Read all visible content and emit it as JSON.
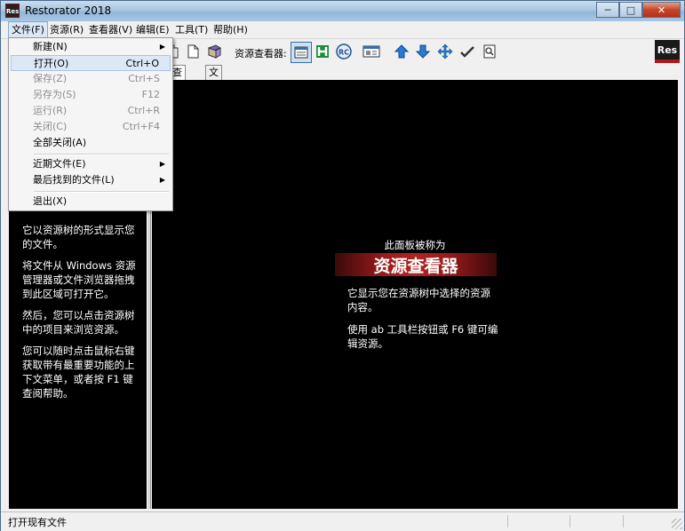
{
  "window": {
    "title": "Restorator 2018",
    "icon_text": "Res"
  },
  "caption": {
    "minimize": "─",
    "maximize": "□",
    "close": "✕"
  },
  "menubar": {
    "file": "文件(F)",
    "resources": "资源(R)",
    "viewer": "查看器(V)",
    "edit": "编辑(E)",
    "tools": "工具(T)",
    "help": "帮助(H)"
  },
  "toolbar": {
    "viewer_label": "资源查看器:",
    "icons": [
      "copy-icon",
      "page-icon",
      "book-icon",
      "viewer-grid-icon",
      "h-icon",
      "rc-icon",
      "resource-icon",
      "arrow-up-icon",
      "arrow-down-icon",
      "move-icon",
      "checkmark-icon",
      "search-page-icon"
    ],
    "logo_text": "Res"
  },
  "file_menu": {
    "items": [
      {
        "label": "新建(N)",
        "shortcut": "",
        "submenu": true,
        "enabled": true
      },
      {
        "label": "打开(O)",
        "shortcut": "Ctrl+O",
        "submenu": false,
        "enabled": true
      },
      {
        "label": "保存(Z)",
        "shortcut": "Ctrl+S",
        "submenu": false,
        "enabled": false
      },
      {
        "label": "另存为(S)",
        "shortcut": "F12",
        "submenu": false,
        "enabled": false
      },
      {
        "label": "运行(R)",
        "shortcut": "Ctrl+R",
        "submenu": false,
        "enabled": false
      },
      {
        "label": "关闭(C)",
        "shortcut": "Ctrl+F4",
        "submenu": false,
        "enabled": false
      },
      {
        "label": "全部关闭(A)",
        "shortcut": "",
        "submenu": false,
        "enabled": true
      },
      {
        "label": "近期文件(E)",
        "shortcut": "",
        "submenu": true,
        "enabled": true
      },
      {
        "label": "最后找到的文件(L)",
        "shortcut": "",
        "submenu": true,
        "enabled": true
      },
      {
        "label": "退出(X)",
        "shortcut": "",
        "submenu": false,
        "enabled": true
      }
    ],
    "submenu_arrow": "▶"
  },
  "left_panel": {
    "paragraphs": [
      "它以资源树的形式显示您的文件。",
      "将文件从 Windows 资源管理器或文件浏览器拖拽到此区域可打开它。",
      "然后，您可以点击资源树中的项目来浏览资源。",
      "您可以随时点击鼠标右键获取带有最重要功能的上下文菜单，或者按 F1 键查阅帮助。"
    ]
  },
  "tabs": {
    "viewer": "查看器",
    "file_browser": "文件浏览器"
  },
  "right_panel": {
    "subtitle": "此面板被称为",
    "banner": "资源查看器",
    "paragraphs": [
      "它显示您在资源树中选择的资源内容。",
      "使用 ab 工具栏按钮或 F6 键可编辑资源。"
    ]
  },
  "statusbar": {
    "text": "打开现有文件"
  }
}
